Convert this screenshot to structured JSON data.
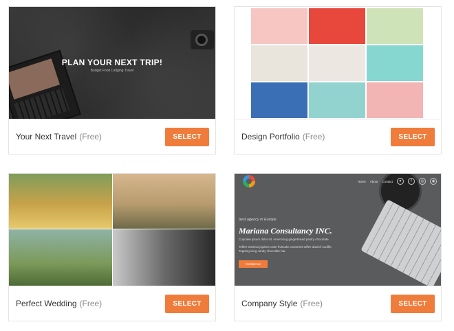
{
  "cards": [
    {
      "title": "Your Next Travel",
      "price_tag": "(Free)",
      "button": "SELECT",
      "preview": {
        "headline": "PLAN YOUR NEXT TRIP!",
        "subline": "Budget Food Lodging Travel"
      }
    },
    {
      "title": "Design Portfolio",
      "price_tag": "(Free)",
      "button": "SELECT",
      "preview": {
        "tiles": [
          "#f7c6c3",
          "#e8483c",
          "#cfe3b8",
          "#e9e4dc",
          "#ece8e1",
          "#86d7cf",
          "#3b6fb5",
          "#92d3cf",
          "#f3b4b4"
        ]
      }
    },
    {
      "title": "Perfect Wedding",
      "price_tag": "(Free)",
      "button": "SELECT",
      "preview": {}
    },
    {
      "title": "Company Style",
      "price_tag": "(Free)",
      "button": "SELECT",
      "preview": {
        "nav": [
          "Home",
          "About",
          "Contact"
        ],
        "tagline": "best agency in Europe",
        "name": "Mariana Consultancy INC.",
        "line1": "Cupcake ipsum dolor sit. Amet icing gingerbread pastry chocolate.",
        "line2": "Toffee tiramisu jujubes cake fruitcake caramels toffee danish souffle. Topping icing candy chocolate bar.",
        "cta": "Contact us"
      }
    }
  ],
  "colors": {
    "accent": "#f07c3b"
  }
}
